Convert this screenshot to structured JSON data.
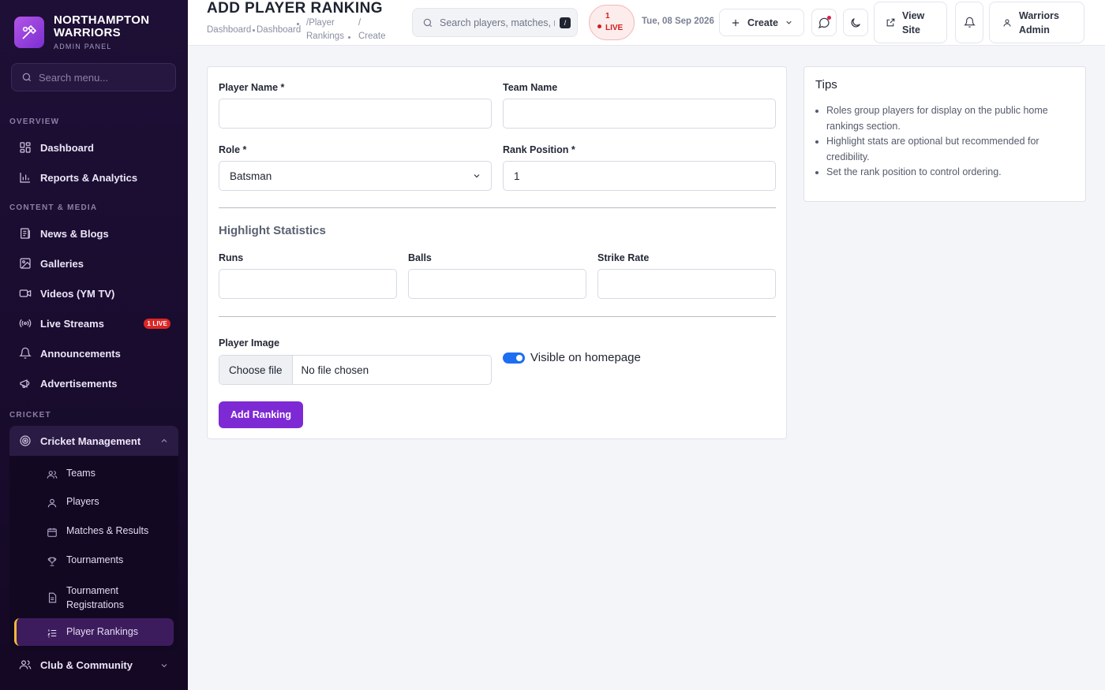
{
  "brand": {
    "name_line1": "NORTHAMPTON",
    "name_line2": "WARRIORS",
    "subtitle": "ADMIN PANEL"
  },
  "sidebar": {
    "search_placeholder": "Search menu...",
    "sections": {
      "overview": "OVERVIEW",
      "content_media": "CONTENT & MEDIA",
      "cricket": "CRICKET"
    },
    "items": {
      "dashboard": "Dashboard",
      "reports": "Reports & Analytics",
      "news": "News & Blogs",
      "galleries": "Galleries",
      "videos": "Videos (YM TV)",
      "live_streams": "Live Streams",
      "live_badge": "1 LIVE",
      "announcements": "Announcements",
      "advertisements": "Advertisements",
      "cricket_management": "Cricket Management",
      "club_community": "Club & Community"
    },
    "submenu": {
      "teams": "Teams",
      "players": "Players",
      "matches": "Matches & Results",
      "tournaments": "Tournaments",
      "registrations_line1": "Tournament",
      "registrations_line2": "Registrations",
      "player_rankings": "Player Rankings"
    }
  },
  "header": {
    "title": "ADD PLAYER RANKING",
    "breadcrumb": {
      "c1": "Dashboard",
      "c2": "Dashboard",
      "c3a": "/Player",
      "c3b": "Rankings",
      "c4a": "/",
      "c4b": "Create"
    },
    "search_placeholder": "Search players, matches, news...",
    "search_kbd": "/",
    "live_count": "1",
    "live_label": "LIVE",
    "date": "Tue, 08 Sep 2026",
    "create_label": "Create",
    "view_site_line1": "View",
    "view_site_line2": "Site",
    "user_line1": "Warriors",
    "user_line2": "Admin"
  },
  "form": {
    "player_name_label": "Player Name *",
    "player_name_value": "",
    "team_name_label": "Team Name",
    "team_name_value": "",
    "role_label": "Role *",
    "role_value": "Batsman",
    "rank_label": "Rank Position *",
    "rank_value": "1",
    "highlight_title": "Highlight Statistics",
    "runs_label": "Runs",
    "balls_label": "Balls",
    "strike_rate_label": "Strike Rate",
    "image_label": "Player Image",
    "file_button": "Choose file",
    "file_status": "No file chosen",
    "visible_label": "Visible on homepage",
    "visible_on": true,
    "submit_label": "Add Ranking"
  },
  "tips": {
    "title": "Tips",
    "items": [
      "Roles group players for display on the public home rankings section.",
      "Highlight stats are optional but recommended for credibility.",
      "Set the rank position to control ordering."
    ]
  },
  "colors": {
    "accent": "#7d2ad4",
    "sidebar_bg": "#1e0f36",
    "live_red": "#dc2626",
    "toggle_blue": "#1d6ef2",
    "active_border": "#f5b83d"
  }
}
